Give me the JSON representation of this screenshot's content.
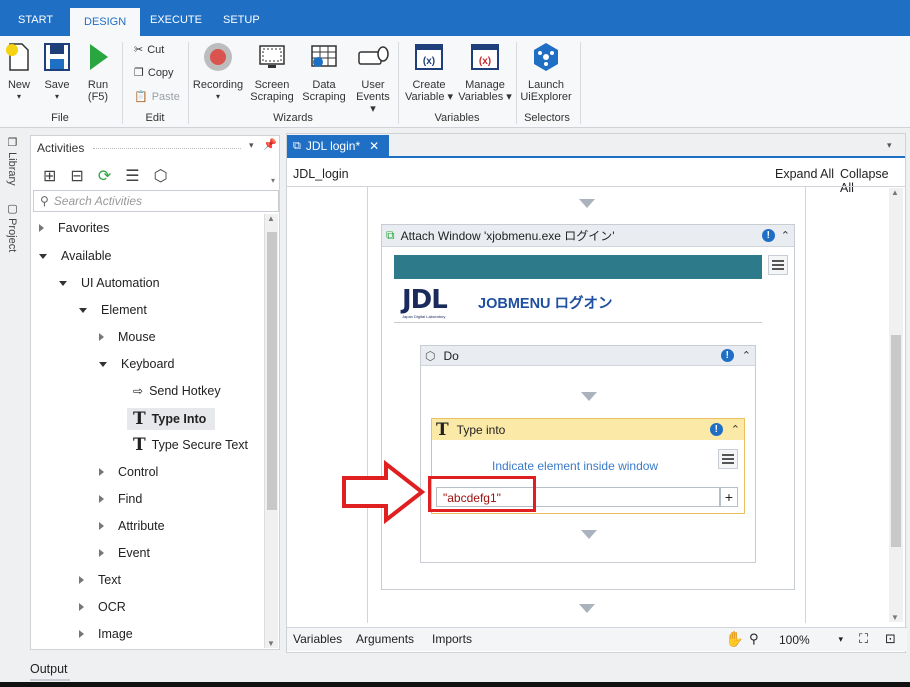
{
  "tabs": [
    "START",
    "DESIGN",
    "EXECUTE",
    "SETUP"
  ],
  "ribbon": {
    "new": "New",
    "save": "Save",
    "run1": "Run",
    "run2": "(F5)",
    "file_group": "File",
    "cut": "Cut",
    "copy": "Copy",
    "paste": "Paste",
    "edit_group": "Edit",
    "recording": "Recording",
    "screen1": "Screen",
    "screen2": "Scraping",
    "data1": "Data",
    "data2": "Scraping",
    "user1": "User",
    "user2": "Events",
    "wizards_group": "Wizards",
    "create1": "Create",
    "create2": "Variable",
    "manage1": "Manage",
    "manage2": "Variables",
    "variables_group": "Variables",
    "launch1": "Launch",
    "launch2": "UiExplorer",
    "selectors_group": "Selectors"
  },
  "left_strip": {
    "library": "Library",
    "project": "Project"
  },
  "activities": {
    "title": "Activities",
    "search_placeholder": "Search Activities",
    "tree": [
      {
        "label": "Favorites"
      },
      {
        "label": "Available"
      },
      {
        "label": "UI Automation"
      },
      {
        "label": "Element"
      },
      {
        "label": "Mouse"
      },
      {
        "label": "Keyboard"
      },
      {
        "label": "Send Hotkey"
      },
      {
        "label": "Type Into"
      },
      {
        "label": "Type Secure Text"
      },
      {
        "label": "Control"
      },
      {
        "label": "Find"
      },
      {
        "label": "Attribute"
      },
      {
        "label": "Event"
      },
      {
        "label": "Text"
      },
      {
        "label": "OCR"
      },
      {
        "label": "Image"
      }
    ]
  },
  "designer": {
    "doc_tab": "JDL login*",
    "breadcrumb": "JDL_login",
    "expand_all": "Expand All",
    "collapse_all": "Collapse All",
    "attach_window": "Attach Window 'xjobmenu.exe ログイン'",
    "logo_text": "JDL",
    "logo_sub": "Japan Digital Laboratory",
    "jobmenu": "JOBMENU ログオン",
    "do_label": "Do",
    "type_into": "Type into",
    "indicate": "Indicate element inside window",
    "text_value": "\"abcdefg1\"",
    "plus": "+"
  },
  "bottom": {
    "variables": "Variables",
    "arguments": "Arguments",
    "imports": "Imports",
    "zoom": "100%"
  },
  "output": "Output",
  "colors": {
    "accent": "#1f6fc5",
    "highlight_red": "#e02020",
    "type_into_bg": "#fbe9a8"
  }
}
